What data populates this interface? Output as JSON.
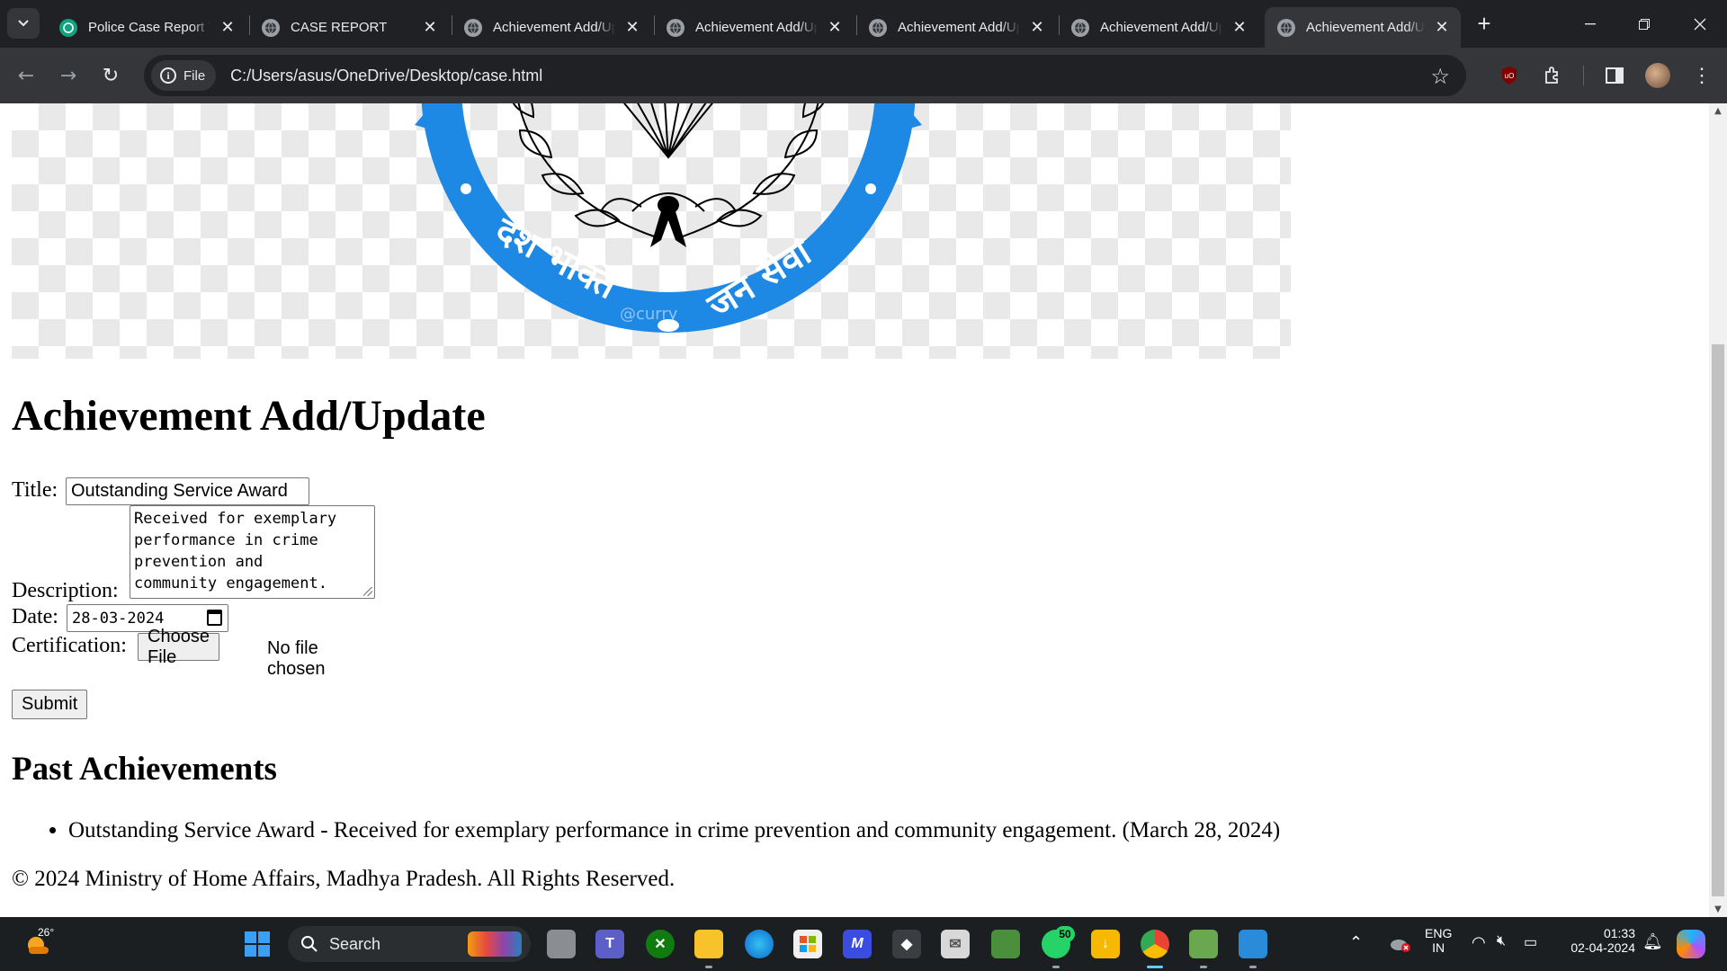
{
  "browser": {
    "tabs": [
      {
        "title": "Police Case Report Te",
        "active": false
      },
      {
        "title": "CASE REPORT",
        "active": false
      },
      {
        "title": "Achievement Add/Up",
        "active": false
      },
      {
        "title": "Achievement Add/Up",
        "active": false
      },
      {
        "title": "Achievement Add/Up",
        "active": false
      },
      {
        "title": "Achievement Add/Up",
        "active": false
      },
      {
        "title": "Achievement Add/Up",
        "active": true
      }
    ],
    "site_info_label": "File",
    "url": "C:/Users/asus/OneDrive/Desktop/case.html"
  },
  "banner": {
    "motto_left": "देश भक्ति",
    "motto_right": "जन सेवा",
    "watermark": "@curry"
  },
  "page": {
    "heading": "Achievement Add/Update",
    "form": {
      "title_label": "Title:",
      "title_value": "Outstanding Service Award",
      "description_label": "Description:",
      "description_value": "Received for exemplary\nperformance in crime\nprevention and\ncommunity engagement.",
      "date_label": "Date:",
      "date_value": "28-03-2024",
      "certification_label": "Certification:",
      "choose_file_label": "Choose File",
      "no_file_text": "No file chosen",
      "submit_label": "Submit"
    },
    "past_heading": "Past Achievements",
    "achievements": [
      "Outstanding Service Award - Received for exemplary performance in crime prevention and community engagement. (March 28, 2024)"
    ],
    "footer": "© 2024 Ministry of Home Affairs, Madhya Pradesh. All Rights Reserved."
  },
  "taskbar": {
    "weather_temp": "26°",
    "search_placeholder": "Search",
    "whatsapp_badge": "50",
    "language_top": "ENG",
    "language_bottom": "IN",
    "time": "01:33",
    "date": "02-04-2024"
  },
  "colors": {
    "chrome_dark": "#202124",
    "chrome_toolbar": "#35363a",
    "emblem_blue": "#1e88e5",
    "taskbar": "#1c1f22"
  }
}
